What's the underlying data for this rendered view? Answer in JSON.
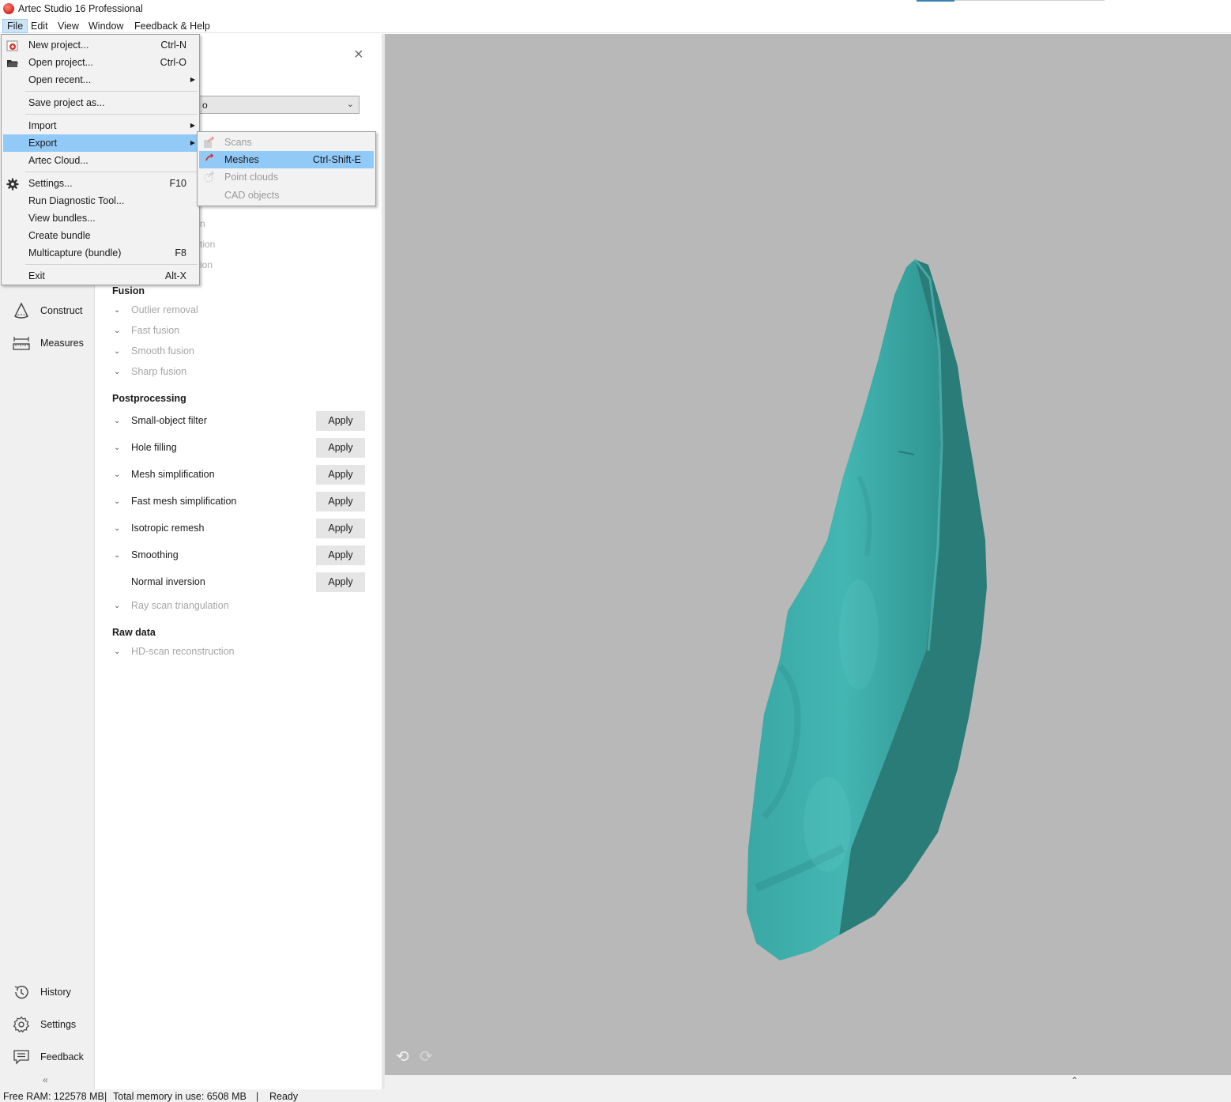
{
  "window": {
    "title": "Artec Studio 16 Professional"
  },
  "menubar": {
    "items": [
      "File",
      "Edit",
      "View",
      "Window",
      "Feedback & Help"
    ],
    "active": "File"
  },
  "leftnav": {
    "top": [
      {
        "label": "Construct",
        "icon": "cone-icon"
      },
      {
        "label": "Measures",
        "icon": "ruler-icon"
      }
    ],
    "bottom": [
      {
        "label": "History",
        "icon": "history-icon"
      },
      {
        "label": "Settings",
        "icon": "gear-icon"
      },
      {
        "label": "Feedback",
        "icon": "comment-icon"
      }
    ],
    "collapse": "«"
  },
  "panel": {
    "dropdown_value": "o",
    "hidden_fragments": [
      "n",
      "tion",
      "ion"
    ],
    "sections": {
      "fusion": {
        "title": "Fusion",
        "items": [
          "Outlier removal",
          "Fast fusion",
          "Smooth fusion",
          "Sharp fusion"
        ]
      },
      "postprocessing": {
        "title": "Postprocessing",
        "items": [
          "Small-object filter",
          "Hole filling",
          "Mesh simplification",
          "Fast mesh simplification",
          "Isotropic remesh",
          "Smoothing",
          "Normal inversion",
          "Ray scan triangulation"
        ],
        "apply_label": "Apply"
      },
      "raw_data": {
        "title": "Raw data",
        "items": [
          "HD-scan reconstruction"
        ]
      }
    }
  },
  "file_menu": {
    "items": [
      {
        "label": "New project...",
        "shortcut": "Ctrl-N"
      },
      {
        "label": "Open project...",
        "shortcut": "Ctrl-O"
      },
      {
        "label": "Open recent..."
      },
      {
        "label": "Save project as..."
      },
      {
        "label": "Import"
      },
      {
        "label": "Export"
      },
      {
        "label": "Artec Cloud..."
      },
      {
        "label": "Settings...",
        "shortcut": "F10"
      },
      {
        "label": "Run Diagnostic Tool..."
      },
      {
        "label": "View bundles..."
      },
      {
        "label": "Create bundle"
      },
      {
        "label": "Multicapture (bundle)",
        "shortcut": "F8"
      },
      {
        "label": "Exit",
        "shortcut": "Alt-X"
      }
    ],
    "highlighted": "Export"
  },
  "export_submenu": {
    "items": [
      {
        "label": "Scans",
        "enabled": false
      },
      {
        "label": "Meshes",
        "shortcut": "Ctrl-Shift-E",
        "enabled": true
      },
      {
        "label": "Point clouds",
        "enabled": false
      },
      {
        "label": "CAD objects",
        "enabled": false
      }
    ],
    "highlighted": "Meshes"
  },
  "viewport": {
    "model_color": "#3fa9a6",
    "background": "#b8b8b8"
  },
  "statusbar": {
    "free_ram": "Free RAM: 122578 MB",
    "total_memory": "Total memory in use: 6508 MB",
    "status": "Ready"
  }
}
